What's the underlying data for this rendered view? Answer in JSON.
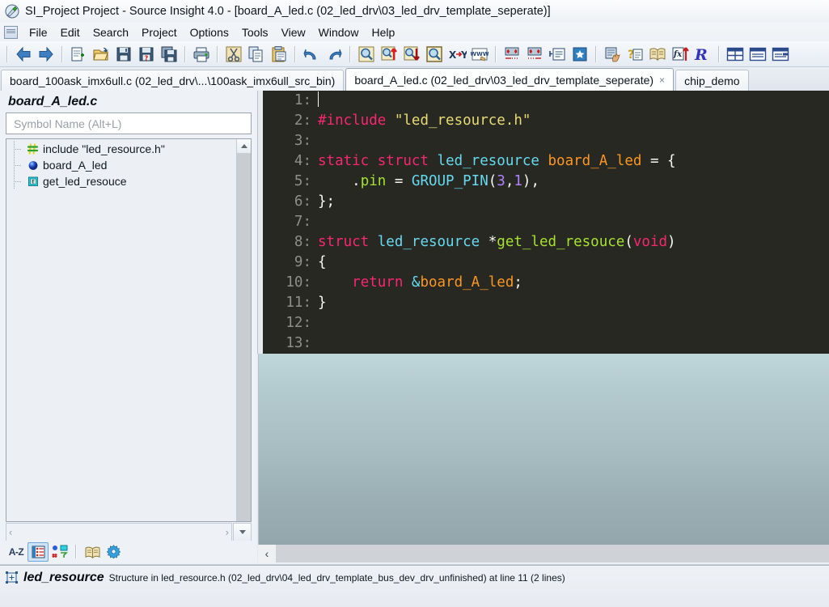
{
  "window": {
    "title": "SI_Project Project - Source Insight 4.0 - [board_A_led.c (02_led_drv\\03_led_drv_template_seperate)]",
    "app_icon": "source-insight-logo"
  },
  "menubar": {
    "items": [
      "File",
      "Edit",
      "Search",
      "Project",
      "Options",
      "Tools",
      "View",
      "Window",
      "Help"
    ]
  },
  "toolbar": {
    "groups": [
      {
        "buttons": [
          {
            "name": "back-icon",
            "tip": "Back"
          },
          {
            "name": "forward-icon",
            "tip": "Forward"
          }
        ]
      },
      {
        "buttons": [
          {
            "name": "new-file-icon",
            "tip": "New File"
          },
          {
            "name": "open-file-icon",
            "tip": "Open File"
          },
          {
            "name": "save-icon",
            "tip": "Save"
          },
          {
            "name": "save-as-icon",
            "tip": "Save As"
          },
          {
            "name": "save-all-icon",
            "tip": "Save All"
          }
        ]
      },
      {
        "buttons": [
          {
            "name": "print-icon",
            "tip": "Print"
          }
        ]
      },
      {
        "buttons": [
          {
            "name": "cut-icon",
            "tip": "Cut"
          },
          {
            "name": "copy-icon",
            "tip": "Copy"
          },
          {
            "name": "paste-icon",
            "tip": "Paste"
          }
        ]
      },
      {
        "buttons": [
          {
            "name": "undo-icon",
            "tip": "Undo"
          },
          {
            "name": "redo-icon",
            "tip": "Redo"
          }
        ]
      },
      {
        "buttons": [
          {
            "name": "search-icon",
            "tip": "Search"
          },
          {
            "name": "search-backward-icon",
            "tip": "Search Backward"
          },
          {
            "name": "search-forward-icon",
            "tip": "Search Forward"
          },
          {
            "name": "search-files-icon",
            "tip": "Search in Files"
          },
          {
            "name": "replace-icon",
            "tip": "Replace"
          },
          {
            "name": "browse-web-icon",
            "tip": "Browse Web"
          }
        ]
      },
      {
        "buttons": [
          {
            "name": "indent-left-icon",
            "tip": "Shift Left"
          },
          {
            "name": "indent-right-icon",
            "tip": "Shift Right"
          },
          {
            "name": "insert-block-icon",
            "tip": "Insert Block"
          },
          {
            "name": "bookmark-icon",
            "tip": "Bookmark"
          }
        ]
      },
      {
        "buttons": [
          {
            "name": "context-window-icon",
            "tip": "Context Window"
          },
          {
            "name": "symbol-info-icon",
            "tip": "Symbol Info"
          },
          {
            "name": "reference-icon",
            "tip": "Reference"
          },
          {
            "name": "jump-to-definition-icon",
            "tip": "Jump To Definition"
          },
          {
            "name": "relation-window-icon",
            "tip": "Relation Window"
          }
        ]
      },
      {
        "buttons": [
          {
            "name": "tile-windows-icon",
            "tip": "Tile Windows"
          },
          {
            "name": "single-pane-icon",
            "tip": "Single Pane"
          },
          {
            "name": "split-pane-icon",
            "tip": "Split Pane"
          }
        ]
      }
    ]
  },
  "tabs": [
    {
      "label": "board_100ask_imx6ull.c (02_led_drv\\...\\100ask_imx6ull_src_bin)",
      "active": false,
      "closable": false
    },
    {
      "label": "board_A_led.c (02_led_drv\\03_led_drv_template_seperate)",
      "active": true,
      "closable": true,
      "close_glyph": "×"
    },
    {
      "label": "chip_demo",
      "active": false,
      "closable": false
    }
  ],
  "sidebar": {
    "file_title": "board_A_led.c",
    "search": {
      "placeholder": "Symbol Name (Alt+L)",
      "value": ""
    },
    "symbols": [
      {
        "label": "include \"led_resource.h\"",
        "icon": "hash-include-icon"
      },
      {
        "label": "board_A_led",
        "icon": "blue-sphere-variable-icon"
      },
      {
        "label": "get_led_resouce",
        "icon": "cyan-function-icon"
      }
    ],
    "scroll_up_glyph": "⌃",
    "hscroll_left_glyph": "‹",
    "hscroll_right_glyph": "›",
    "dropdown_glyph": "⌄",
    "footer_buttons": [
      {
        "name": "sort-alphabetical-button",
        "label": "A-Z",
        "selected": false
      },
      {
        "name": "symbol-list-button",
        "label": "",
        "selected": true
      },
      {
        "name": "symbol-types-button",
        "label": "",
        "selected": false
      },
      {
        "name": "browse-button",
        "label": "",
        "selected": false
      },
      {
        "name": "options-button",
        "label": "",
        "selected": false
      }
    ]
  },
  "editor": {
    "lines": [
      {
        "num": "1:",
        "tokens": [
          {
            "t": "cursor",
            "v": ""
          }
        ]
      },
      {
        "num": "2:",
        "tokens": [
          {
            "t": "pre",
            "v": "#include"
          },
          {
            "t": "punc",
            "v": " "
          },
          {
            "t": "str",
            "v": "\"led_resource.h\""
          }
        ]
      },
      {
        "num": "3:",
        "tokens": []
      },
      {
        "num": "4:",
        "tokens": [
          {
            "t": "kw",
            "v": "static"
          },
          {
            "t": "punc",
            "v": " "
          },
          {
            "t": "kw",
            "v": "struct"
          },
          {
            "t": "punc",
            "v": " "
          },
          {
            "t": "type",
            "v": "led_resource"
          },
          {
            "t": "punc",
            "v": " "
          },
          {
            "t": "var",
            "v": "board_A_led"
          },
          {
            "t": "punc",
            "v": " = {"
          }
        ]
      },
      {
        "num": "5:",
        "tokens": [
          {
            "t": "punc",
            "v": "    ."
          },
          {
            "t": "member",
            "v": "pin"
          },
          {
            "t": "punc",
            "v": " = "
          },
          {
            "t": "macro",
            "v": "GROUP_PIN"
          },
          {
            "t": "punc",
            "v": "("
          },
          {
            "t": "num",
            "v": "3"
          },
          {
            "t": "punc",
            "v": ","
          },
          {
            "t": "num",
            "v": "1"
          },
          {
            "t": "punc",
            "v": "),"
          }
        ]
      },
      {
        "num": "6:",
        "tokens": [
          {
            "t": "punc",
            "v": "};"
          }
        ]
      },
      {
        "num": "7:",
        "tokens": []
      },
      {
        "num": "8:",
        "tokens": [
          {
            "t": "kw",
            "v": "struct"
          },
          {
            "t": "punc",
            "v": " "
          },
          {
            "t": "type",
            "v": "led_resource"
          },
          {
            "t": "punc",
            "v": " *"
          },
          {
            "t": "fn",
            "v": "get_led_resouce"
          },
          {
            "t": "punc",
            "v": "("
          },
          {
            "t": "kw",
            "v": "void"
          },
          {
            "t": "punc",
            "v": ")"
          }
        ]
      },
      {
        "num": "9:",
        "tokens": [
          {
            "t": "punc",
            "v": "{"
          }
        ]
      },
      {
        "num": "10:",
        "tokens": [
          {
            "t": "punc",
            "v": "    "
          },
          {
            "t": "kw",
            "v": "return"
          },
          {
            "t": "punc",
            "v": " "
          },
          {
            "t": "type",
            "v": "&"
          },
          {
            "t": "var",
            "v": "board_A_led"
          },
          {
            "t": "punc",
            "v": ";"
          }
        ]
      },
      {
        "num": "11:",
        "tokens": [
          {
            "t": "punc",
            "v": "}"
          }
        ]
      },
      {
        "num": "12:",
        "tokens": []
      },
      {
        "num": "13:",
        "tokens": []
      }
    ],
    "hscroll_left_glyph": "‹"
  },
  "statusbar": {
    "icon": "structure-symbol-icon",
    "symbol": "led_resource",
    "description": "Structure in led_resource.h (02_led_drv\\04_led_drv_template_bus_dev_drv_unfinished) at line 11 (2 lines)"
  },
  "colors": {
    "editor_bg": "#272818",
    "keyword": "#f92672",
    "type": "#66d9ef",
    "string": "#e6db74",
    "variable": "#fd971f",
    "function": "#a6e22e",
    "number": "#ae81ff",
    "linenumber": "#8d8f89",
    "chrome": "#eef1f5",
    "accent": "#3a6ea5"
  }
}
